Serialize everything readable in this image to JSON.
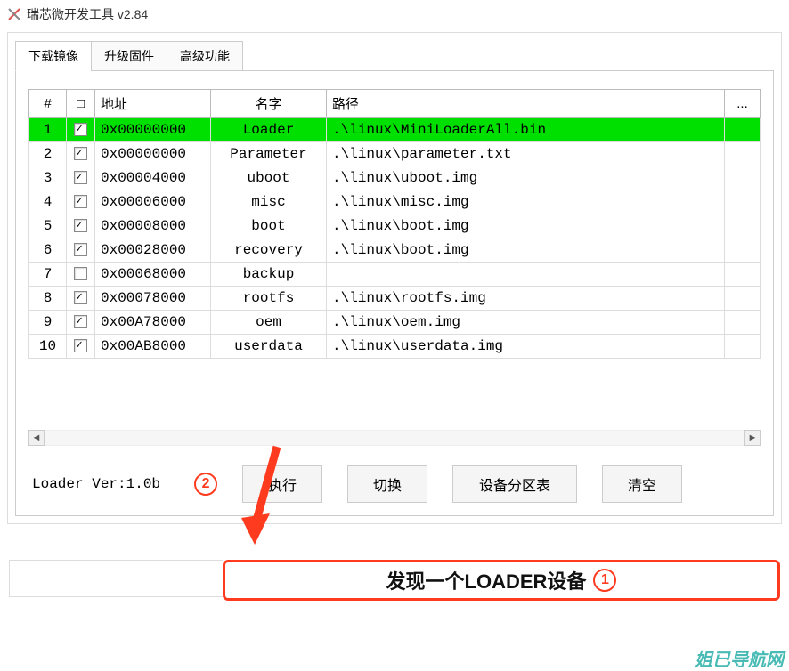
{
  "window": {
    "title": "瑞芯微开发工具 v2.84"
  },
  "tabs": {
    "download": "下载镜像",
    "upgrade": "升级固件",
    "advanced": "高级功能",
    "active": "download"
  },
  "table": {
    "headers": {
      "num": "#",
      "chk": "□",
      "addr": "地址",
      "name": "名字",
      "path": "路径",
      "more": "..."
    },
    "rows": [
      {
        "n": "1",
        "chk": true,
        "addr": "0x00000000",
        "name": "Loader",
        "path": ".\\linux\\MiniLoaderAll.bin",
        "selected": true
      },
      {
        "n": "2",
        "chk": true,
        "addr": "0x00000000",
        "name": "Parameter",
        "path": ".\\linux\\parameter.txt",
        "selected": false
      },
      {
        "n": "3",
        "chk": true,
        "addr": "0x00004000",
        "name": "uboot",
        "path": ".\\linux\\uboot.img",
        "selected": false
      },
      {
        "n": "4",
        "chk": true,
        "addr": "0x00006000",
        "name": "misc",
        "path": ".\\linux\\misc.img",
        "selected": false
      },
      {
        "n": "5",
        "chk": true,
        "addr": "0x00008000",
        "name": "boot",
        "path": ".\\linux\\boot.img",
        "selected": false
      },
      {
        "n": "6",
        "chk": true,
        "addr": "0x00028000",
        "name": "recovery",
        "path": ".\\linux\\boot.img",
        "selected": false
      },
      {
        "n": "7",
        "chk": false,
        "addr": "0x00068000",
        "name": "backup",
        "path": "",
        "selected": false
      },
      {
        "n": "8",
        "chk": true,
        "addr": "0x00078000",
        "name": "rootfs",
        "path": ".\\linux\\rootfs.img",
        "selected": false
      },
      {
        "n": "9",
        "chk": true,
        "addr": "0x00A78000",
        "name": "oem",
        "path": ".\\linux\\oem.img",
        "selected": false
      },
      {
        "n": "10",
        "chk": true,
        "addr": "0x00AB8000",
        "name": "userdata",
        "path": ".\\linux\\userdata.img",
        "selected": false
      }
    ]
  },
  "loader": {
    "label": "Loader Ver:1.0b"
  },
  "buttons": {
    "execute": "执行",
    "switch": "切换",
    "partition": "设备分区表",
    "clear": "清空"
  },
  "annotations": {
    "a1": "1",
    "a2": "2"
  },
  "status": {
    "text": "发现一个LOADER设备"
  },
  "watermark": "姐已导航网"
}
